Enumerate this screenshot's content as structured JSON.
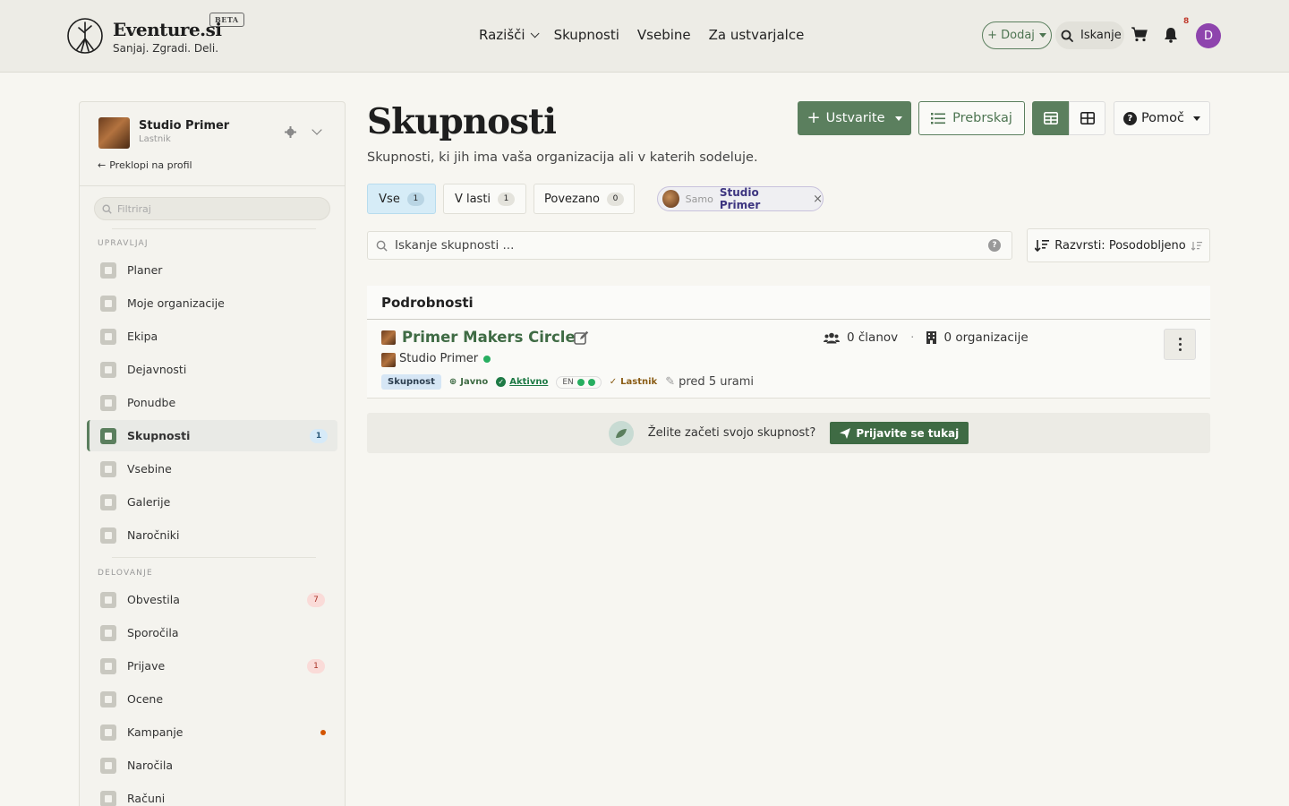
{
  "header": {
    "brand": "Eventure.si",
    "beta": "BETA",
    "tagline": "Sanjaj. Zgradi. Deli.",
    "nav": [
      "Razišči",
      "Skupnosti",
      "Vsebine",
      "Za ustvarjalce"
    ],
    "add_label": "+ Dodaj",
    "search_label": "Iskanje",
    "notifications_count": "8",
    "avatar_initial": "D",
    "avatar_color": "#8e44ad"
  },
  "sidebar": {
    "org_name": "Studio Primer",
    "org_role": "Lastnik",
    "switch_label": "Preklopi na profil",
    "filter_placeholder": "Filtriraj",
    "manage_label": "UPRAVLJAJ",
    "manage_items": [
      {
        "label": "Planer"
      },
      {
        "label": "Moje organizacije"
      },
      {
        "label": "Ekipa"
      },
      {
        "label": "Dejavnosti"
      },
      {
        "label": "Ponudbe"
      },
      {
        "label": "Skupnosti",
        "badge": "1"
      },
      {
        "label": "Vsebine"
      },
      {
        "label": "Galerije"
      },
      {
        "label": "Naročniki"
      }
    ],
    "ops_label": "DELOVANJE",
    "ops_items": [
      {
        "label": "Obvestila",
        "badge": "7"
      },
      {
        "label": "Sporočila"
      },
      {
        "label": "Prijave",
        "badge": "1"
      },
      {
        "label": "Ocene"
      },
      {
        "label": "Kampanje"
      },
      {
        "label": "Naročila"
      },
      {
        "label": "Računi"
      }
    ]
  },
  "main": {
    "title": "Skupnosti",
    "subtitle": "Skupnosti, ki jih ima vaša organizacija ali v katerih sodeluje.",
    "create_label": "Ustvarite",
    "browse_label": "Prebrskaj",
    "help_label": "Pomoč",
    "tabs": [
      {
        "label": "Vse",
        "count": "1"
      },
      {
        "label": "V lasti",
        "count": "1"
      },
      {
        "label": "Povezano",
        "count": "0"
      }
    ],
    "owner_chip": {
      "prefix": "Samo",
      "name": "Studio Primer",
      "close": "×"
    },
    "search_placeholder": "Iskanje skupnosti ...",
    "search_help": "?",
    "sort_label": "Razvrsti: Posodobljeno",
    "details_title": "Podrobnosti",
    "community": {
      "name": "Primer Makers Circle",
      "org": "Studio Primer",
      "members": "0 članov",
      "separator": "·",
      "orgs": "0 organizacije",
      "tag_type": "Skupnost",
      "tag_public": "Javno",
      "tag_active": "Aktivno",
      "tag_lang": "EN",
      "tag_owner": "Lastnik",
      "updated": "pred 5 urami"
    },
    "cta_text": "Želite začeti svojo skupnost?",
    "cta_button": "Prijavite se tukaj"
  },
  "colors": {
    "primary": "#5b7f5e",
    "link": "#3f6b44",
    "active_tab": "#d6ecf7"
  }
}
